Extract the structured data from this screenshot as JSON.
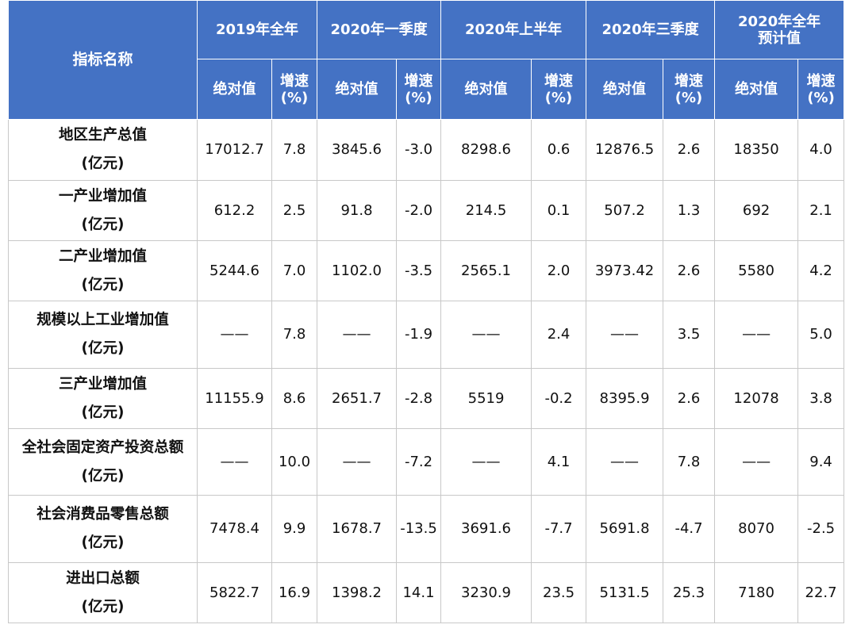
{
  "header": {
    "indicator_label": "指标名称",
    "periods": [
      {
        "label_lines": [
          "2019年全年"
        ]
      },
      {
        "label_lines": [
          "2020年一季度"
        ]
      },
      {
        "label_lines": [
          "2020年上半年"
        ]
      },
      {
        "label_lines": [
          "2020年三季度"
        ]
      },
      {
        "label_lines": [
          "2020年全年",
          "预计值"
        ]
      }
    ],
    "abs_label": "绝对值",
    "growth_label_lines": [
      "增速",
      "(%)"
    ]
  },
  "rows": [
    {
      "name": "地区生产总值",
      "unit": "(亿元)",
      "cells": [
        "17012.7",
        "7.8",
        "3845.6",
        "-3.0",
        "8298.6",
        "0.6",
        "12876.5",
        "2.6",
        "18350",
        "4.0"
      ]
    },
    {
      "name": "一产业增加值",
      "unit": "(亿元)",
      "cells": [
        "612.2",
        "2.5",
        "91.8",
        "-2.0",
        "214.5",
        "0.1",
        "507.2",
        "1.3",
        "692",
        "2.1"
      ]
    },
    {
      "name": "二产业增加值",
      "unit": "(亿元)",
      "cells": [
        "5244.6",
        "7.0",
        "1102.0",
        "-3.5",
        "2565.1",
        "2.0",
        "3973.42",
        "2.6",
        "5580",
        "4.2"
      ]
    },
    {
      "name": "规模以上工业增加值",
      "unit": "(亿元)",
      "cells": [
        "——",
        "7.8",
        "——",
        "-1.9",
        "——",
        "2.4",
        "——",
        "3.5",
        "——",
        "5.0"
      ]
    },
    {
      "name": "三产业增加值",
      "unit": "(亿元)",
      "cells": [
        "11155.9",
        "8.6",
        "2651.7",
        "-2.8",
        "5519",
        "-0.2",
        "8395.9",
        "2.6",
        "12078",
        "3.8"
      ]
    },
    {
      "name": "全社会固定资产投资总额",
      "unit": "(亿元)",
      "cells": [
        "——",
        "10.0",
        "——",
        "-7.2",
        "——",
        "4.1",
        "——",
        "7.8",
        "——",
        "9.4"
      ]
    },
    {
      "name": "社会消费品零售总额",
      "unit": "(亿元)",
      "cells": [
        "7478.4",
        "9.9",
        "1678.7",
        "-13.5",
        "3691.6",
        "-7.7",
        "5691.8",
        "-4.7",
        "8070",
        "-2.5"
      ]
    },
    {
      "name": "进出口总额",
      "unit": "(亿元)",
      "cells": [
        "5822.7",
        "16.9",
        "1398.2",
        "14.1",
        "3230.9",
        "23.5",
        "5131.5",
        "25.3",
        "7180",
        "22.7"
      ]
    }
  ]
}
